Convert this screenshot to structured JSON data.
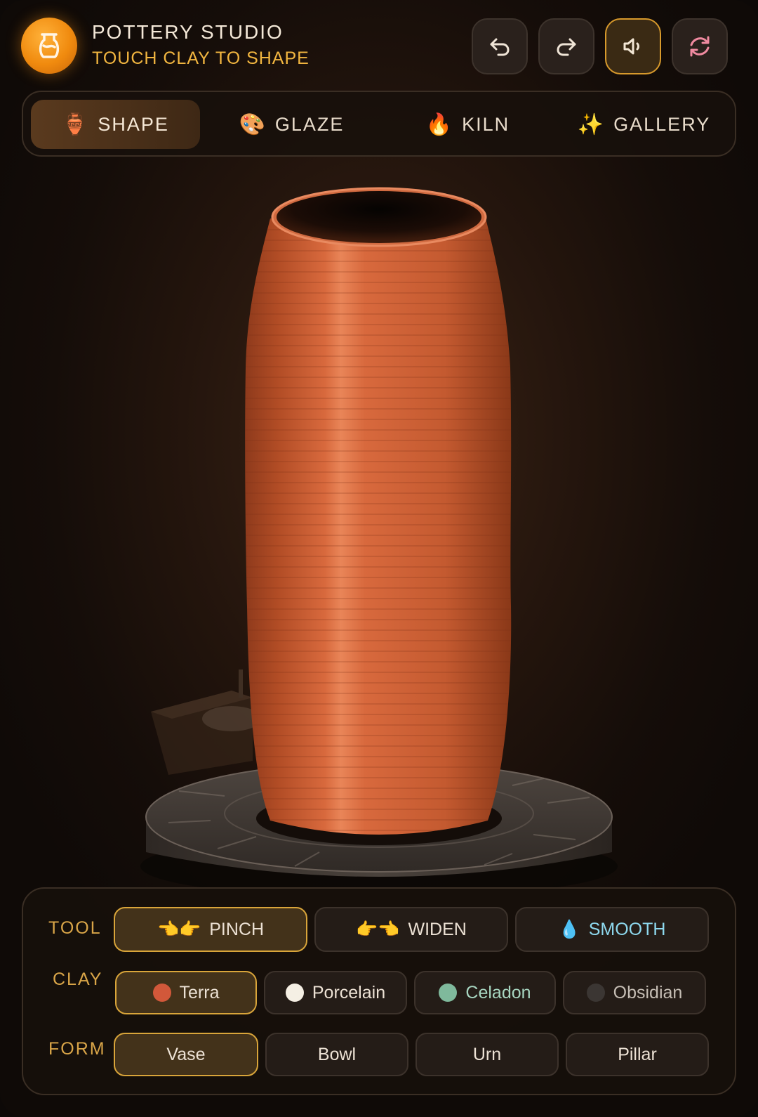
{
  "header": {
    "title": "POTTERY STUDIO",
    "subtitle": "TOUCH CLAY TO SHAPE",
    "buttons": [
      {
        "name": "undo",
        "icon": "undo-icon"
      },
      {
        "name": "redo",
        "icon": "redo-icon"
      },
      {
        "name": "sound",
        "icon": "speaker-icon",
        "active": true
      },
      {
        "name": "reset",
        "icon": "refresh-icon"
      }
    ]
  },
  "tabs": [
    {
      "emoji": "🏺",
      "label": "SHAPE",
      "active": true
    },
    {
      "emoji": "🎨",
      "label": "GLAZE"
    },
    {
      "emoji": "🔥",
      "label": "KILN"
    },
    {
      "emoji": "✨",
      "label": "GALLERY"
    }
  ],
  "controls": {
    "tool": {
      "label": "TOOL",
      "options": [
        {
          "emoji": "👈👉",
          "label": "PINCH",
          "active": true
        },
        {
          "emoji": "👉👈",
          "label": "WIDEN"
        },
        {
          "emoji": "💧",
          "label": "SMOOTH"
        }
      ]
    },
    "clay": {
      "label": "CLAY",
      "options": [
        {
          "label": "Terra",
          "color": "#d2583a",
          "active": true
        },
        {
          "label": "Porcelain",
          "color": "#f5efe4"
        },
        {
          "label": "Celadon",
          "color": "#7fb99c"
        },
        {
          "label": "Obsidian",
          "color": "#3b3633"
        }
      ]
    },
    "form": {
      "label": "FORM",
      "options": [
        {
          "label": "Vase",
          "active": true
        },
        {
          "label": "Bowl"
        },
        {
          "label": "Urn"
        },
        {
          "label": "Pillar"
        }
      ]
    }
  },
  "colors": {
    "accent": "#f29a1a",
    "clay": "#c8603a"
  }
}
